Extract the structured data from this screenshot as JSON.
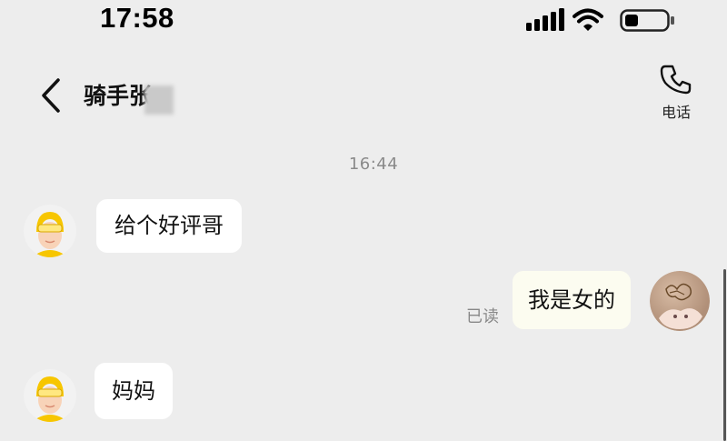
{
  "status_bar": {
    "time": "17:58",
    "icons": [
      "signal-icon",
      "wifi-icon",
      "battery-icon"
    ]
  },
  "header": {
    "back_icon": "chevron-left-icon",
    "title": "骑手张",
    "call_icon": "phone-icon",
    "call_label": "电话"
  },
  "chat": {
    "timestamp": "16:44",
    "messages": [
      {
        "sender": "rider",
        "text": "给个好评哥",
        "avatar": "rider-avatar"
      },
      {
        "sender": "self",
        "text": "我是女的",
        "read_status": "已读",
        "avatar": "user-avatar"
      },
      {
        "sender": "rider",
        "text": "妈妈",
        "avatar": "rider-avatar"
      }
    ]
  },
  "colors": {
    "background": "#ededed",
    "bubble_incoming": "#ffffff",
    "bubble_outgoing": "#fcfcf0",
    "rider_helmet": "#f7c600"
  }
}
